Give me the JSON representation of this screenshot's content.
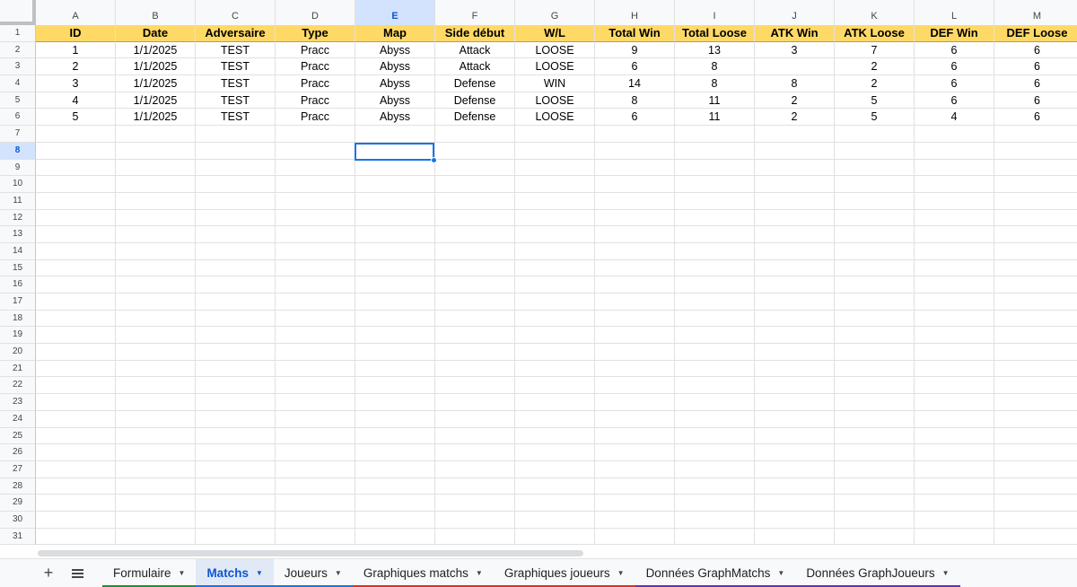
{
  "sheet": {
    "columns": [
      "A",
      "B",
      "C",
      "D",
      "E",
      "F",
      "G",
      "H",
      "I",
      "J",
      "K",
      "L",
      "M"
    ],
    "selected_column": "E",
    "selected_row": 8,
    "row_numbers": [
      "1",
      "2",
      "3",
      "4",
      "5",
      "6",
      "7",
      "8",
      "9",
      "10",
      "11",
      "12",
      "13",
      "14",
      "15",
      "16",
      "17",
      "18",
      "19",
      "20",
      "21",
      "22",
      "23",
      "24",
      "25",
      "26",
      "27",
      "28",
      "29",
      "30",
      "31"
    ],
    "header": [
      "ID",
      "Date",
      "Adversaire",
      "Type",
      "Map",
      "Side début",
      "W/L",
      "Total Win",
      "Total Loose",
      "ATK Win",
      "ATK Loose",
      "DEF Win",
      "DEF Loose"
    ],
    "header_color": "#ffd966",
    "rows": [
      [
        "1",
        "1/1/2025",
        "TEST",
        "Pracc",
        "Abyss",
        "Attack",
        "LOOSE",
        "9",
        "13",
        "3",
        "7",
        "6",
        "6"
      ],
      [
        "2",
        "1/1/2025",
        "TEST",
        "Pracc",
        "Abyss",
        "Attack",
        "LOOSE",
        "6",
        "8",
        "",
        "2",
        "6",
        "6"
      ],
      [
        "3",
        "1/1/2025",
        "TEST",
        "Pracc",
        "Abyss",
        "Defense",
        "WIN",
        "14",
        "8",
        "8",
        "2",
        "6",
        "6"
      ],
      [
        "4",
        "1/1/2025",
        "TEST",
        "Pracc",
        "Abyss",
        "Defense",
        "LOOSE",
        "8",
        "11",
        "2",
        "5",
        "6",
        "6"
      ],
      [
        "5",
        "1/1/2025",
        "TEST",
        "Pracc",
        "Abyss",
        "Defense",
        "LOOSE",
        "6",
        "11",
        "2",
        "5",
        "4",
        "6"
      ]
    ]
  },
  "tabbar": {
    "add_icon": "plus-icon",
    "menu_icon": "menu-icon",
    "tabs": [
      {
        "label": "Formulaire",
        "color": "#1e8e3e",
        "active": false
      },
      {
        "label": "Matchs",
        "color": "#1a73e8",
        "active": true
      },
      {
        "label": "Joueurs",
        "color": "#1a73e8",
        "active": false
      },
      {
        "label": "Graphiques matchs",
        "color": "#d93025",
        "active": false
      },
      {
        "label": "Graphiques joueurs",
        "color": "#d93025",
        "active": false
      },
      {
        "label": "Données GraphMatchs",
        "color": "#5e35b1",
        "active": false
      },
      {
        "label": "Données GraphJoueurs",
        "color": "#5e35b1",
        "active": false
      }
    ]
  }
}
